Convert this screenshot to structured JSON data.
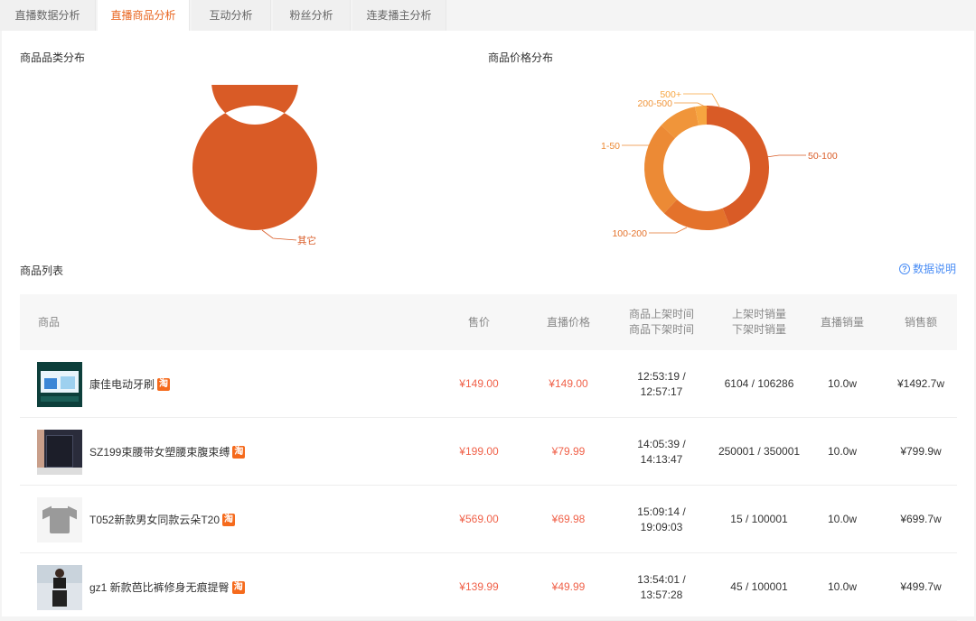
{
  "tabs": [
    {
      "label": "直播数据分析",
      "active": false
    },
    {
      "label": "直播商品分析",
      "active": true
    },
    {
      "label": "互动分析",
      "active": false
    },
    {
      "label": "粉丝分析",
      "active": false
    },
    {
      "label": "连麦播主分析",
      "active": false
    }
  ],
  "sections": {
    "category_title": "商品品类分布",
    "price_title": "商品价格分布",
    "list_title": "商品列表",
    "help_label": "数据说明"
  },
  "colors": {
    "accent": "#e8651f",
    "price_red": "#f0624a",
    "link_blue": "#4a8df5"
  },
  "chart_data": [
    {
      "type": "pie",
      "title": "商品品类分布",
      "categories": [
        "其它"
      ],
      "values": [
        100
      ],
      "colors": [
        "#d95b26"
      ]
    },
    {
      "type": "pie",
      "title": "商品价格分布",
      "categories": [
        "50-100",
        "100-200",
        "1-50",
        "200-500",
        "500+"
      ],
      "values": [
        44,
        18,
        25,
        10,
        3
      ],
      "colors": [
        "#d95b26",
        "#e4722b",
        "#ec8a35",
        "#f0953a",
        "#f6a540"
      ]
    }
  ],
  "table": {
    "headers": {
      "product": "商品",
      "price": "售价",
      "live_price": "直播价格",
      "time_line1": "商品上架时间",
      "time_line2": "商品下架时间",
      "sales_line1": "上架时销量",
      "sales_line2": "下架时销量",
      "live_sales": "直播销量",
      "revenue": "销售额"
    },
    "rows": [
      {
        "name": "康佳电动牙刷",
        "badge": "淘",
        "price": "¥149.00",
        "live_price": "¥149.00",
        "time_on": "12:53:19 /",
        "time_off": "12:57:17",
        "sales": "6104 / 106286",
        "live_sales": "10.0w",
        "revenue": "¥1492.7w"
      },
      {
        "name": "SZ199束腰带女塑腰束腹束缚",
        "badge": "淘",
        "price": "¥199.00",
        "live_price": "¥79.99",
        "time_on": "14:05:39 /",
        "time_off": "14:13:47",
        "sales": "250001 / 350001",
        "live_sales": "10.0w",
        "revenue": "¥799.9w"
      },
      {
        "name": "T052新款男女同款云朵T20",
        "badge": "淘",
        "price": "¥569.00",
        "live_price": "¥69.98",
        "time_on": "15:09:14 /",
        "time_off": "19:09:03",
        "sales": "15 / 100001",
        "live_sales": "10.0w",
        "revenue": "¥699.7w"
      },
      {
        "name": "gz1 新款芭比裤修身无痕提臀",
        "badge": "淘",
        "price": "¥139.99",
        "live_price": "¥49.99",
        "time_on": "13:54:01 /",
        "time_off": "13:57:28",
        "sales": "45 / 100001",
        "live_sales": "10.0w",
        "revenue": "¥499.7w"
      }
    ]
  }
}
